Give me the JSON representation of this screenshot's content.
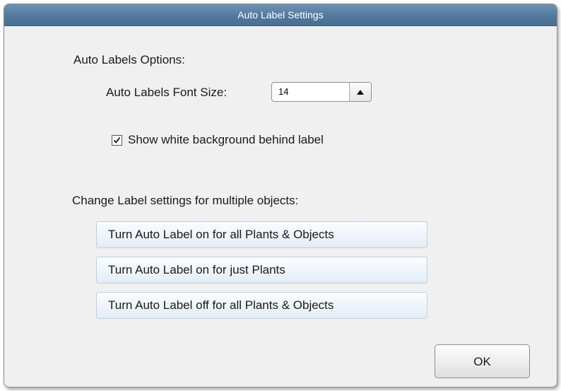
{
  "window": {
    "title": "Auto Label Settings"
  },
  "auto_labels": {
    "section_label": "Auto Labels Options:",
    "font_size_label": "Auto Labels Font Size:",
    "font_size_value": "14",
    "spinner_icon": "up-arrow-icon",
    "show_white_background": {
      "checked": true,
      "label": "Show white background behind label"
    }
  },
  "multiple_objects": {
    "section_label": "Change Label settings for multiple objects:",
    "buttons": [
      {
        "label": "Turn Auto Label on for all Plants & Objects"
      },
      {
        "label": "Turn Auto Label on for just Plants"
      },
      {
        "label": "Turn Auto Label off for all Plants & Objects"
      }
    ]
  },
  "footer": {
    "ok_label": "OK"
  },
  "colors": {
    "titlebar": "#52799c",
    "dialog_background": "#f0f0f0",
    "button_border": "#bcd0e3"
  }
}
